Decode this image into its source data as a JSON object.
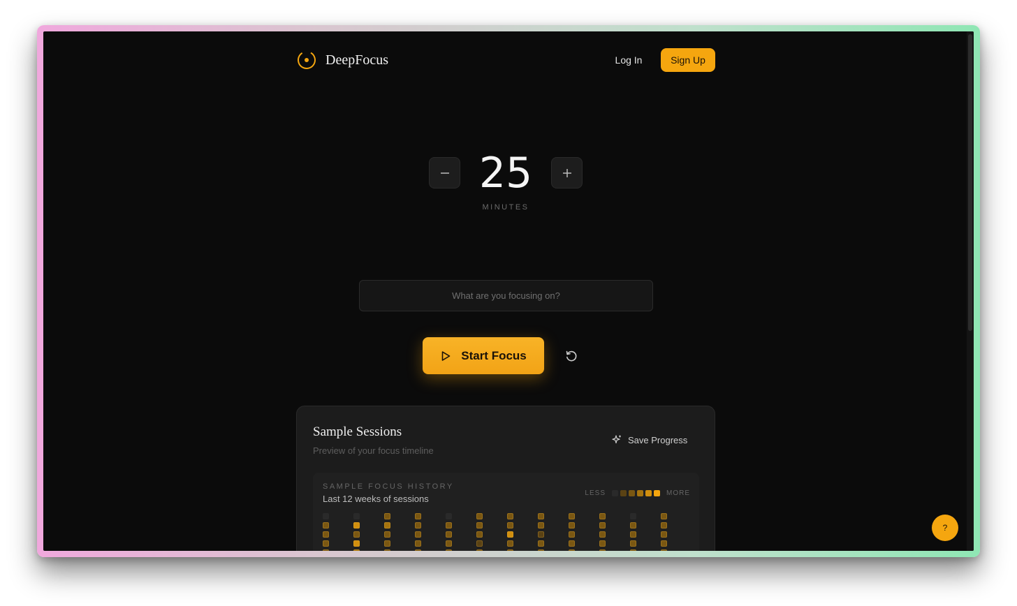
{
  "brand": {
    "name": "DeepFocus",
    "accent": "#f5a60f"
  },
  "nav": {
    "login_label": "Log In",
    "signup_label": "Sign Up"
  },
  "timer": {
    "minutes": "25",
    "unit_label": "MINUTES"
  },
  "focus": {
    "placeholder": "What are you focusing on?"
  },
  "actions": {
    "start_label": "Start Focus"
  },
  "sessions": {
    "title": "Sample Sessions",
    "subtitle": "Preview of your focus timeline",
    "save_label": "Save Progress",
    "history": {
      "label": "SAMPLE FOCUS HISTORY",
      "subtitle": "Last 12 weeks of sessions",
      "legend_less": "LESS",
      "legend_more": "MORE",
      "legend_colors": [
        "#2a2a2a",
        "#5a4214",
        "#7a5712",
        "#a6740f",
        "#d18f0f",
        "#f5a60f"
      ],
      "weeks": [
        [
          0,
          2,
          2,
          2,
          2
        ],
        [
          0,
          4,
          2,
          4,
          3
        ],
        [
          2,
          3,
          2,
          2,
          2
        ],
        [
          2,
          2,
          2,
          2,
          2
        ],
        [
          0,
          2,
          2,
          2,
          2
        ],
        [
          2,
          2,
          2,
          1,
          2
        ],
        [
          2,
          2,
          4,
          2,
          2
        ],
        [
          2,
          2,
          1,
          2,
          2
        ],
        [
          2,
          2,
          2,
          2,
          2
        ],
        [
          2,
          2,
          2,
          2,
          2
        ],
        [
          0,
          2,
          2,
          2,
          2
        ],
        [
          2,
          2,
          2,
          2,
          2
        ]
      ]
    }
  },
  "help": {
    "label": "?"
  }
}
